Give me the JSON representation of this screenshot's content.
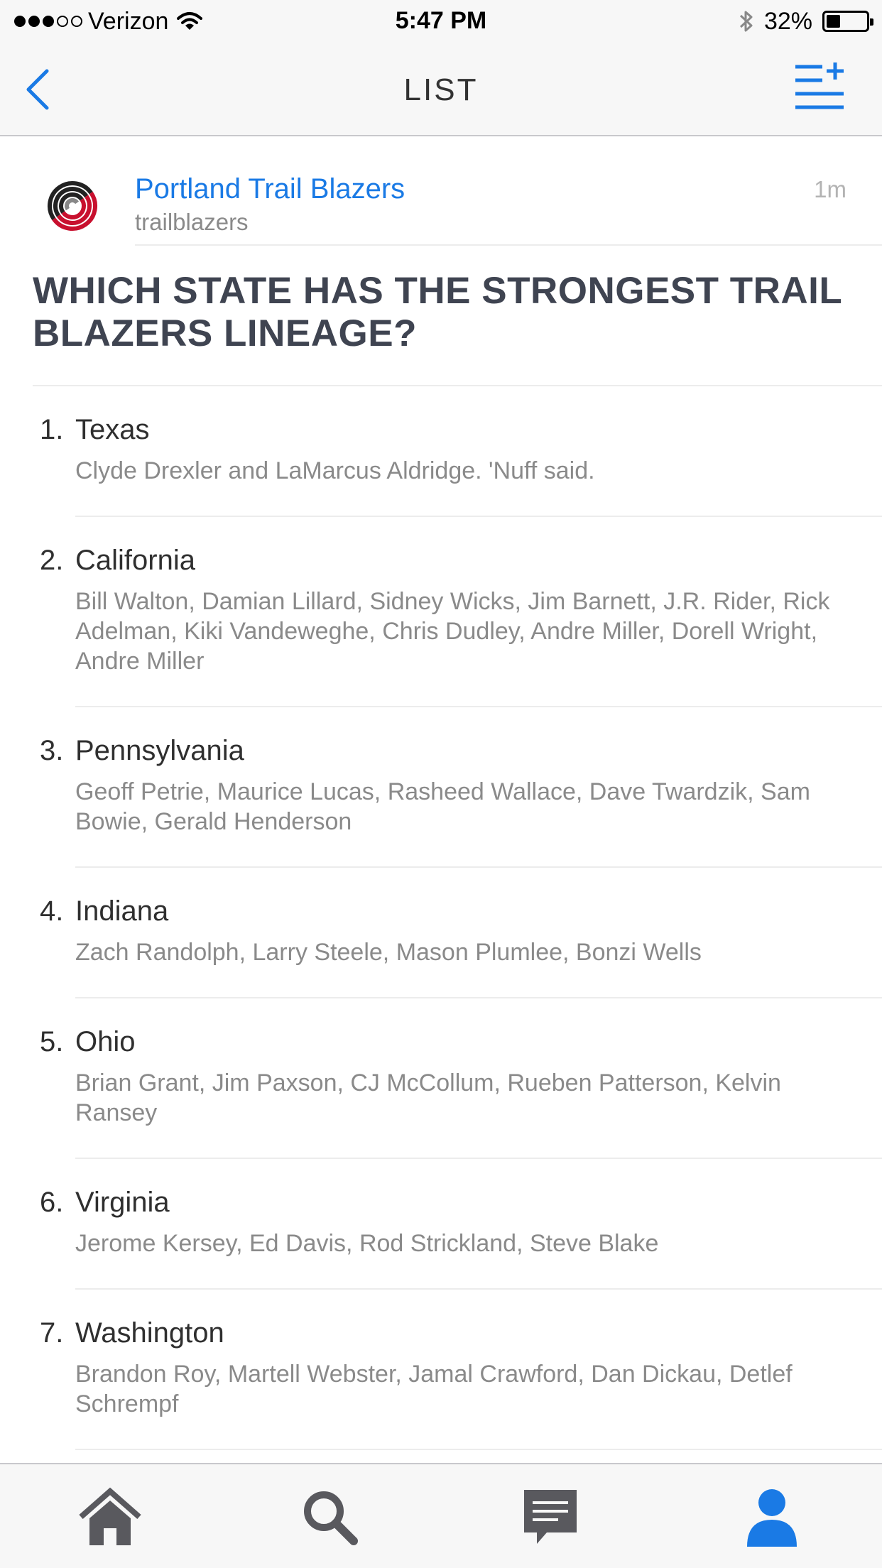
{
  "status_bar": {
    "carrier": "Verizon",
    "signal_dots": 5,
    "signal_filled": 3,
    "time": "5:47 PM",
    "battery_percent_text": "32%",
    "battery_level": 0.32
  },
  "nav": {
    "title": "LIST",
    "back_icon": "chevron-left-icon",
    "action_icon": "add-list-icon",
    "accent_color": "#1a7ae5"
  },
  "post": {
    "author_name": "Portland Trail Blazers",
    "author_handle": "trailblazers",
    "time_ago": "1m",
    "title": "WHICH STATE HAS THE STRONGEST TRAIL BLAZERS LINEAGE?"
  },
  "items": [
    {
      "number": "1.",
      "name": "Texas",
      "description": "Clyde Drexler and LaMarcus Aldridge. 'Nuff said."
    },
    {
      "number": "2.",
      "name": "California",
      "description": "Bill Walton, Damian Lillard, Sidney Wicks, Jim Barnett, J.R. Rider, Rick Adelman, Kiki Vandeweghe, Chris Dudley, Andre Miller, Dorell Wright, Andre Miller"
    },
    {
      "number": "3.",
      "name": "Pennsylvania",
      "description": "Geoff Petrie, Maurice Lucas, Rasheed Wallace, Dave Twardzik, Sam Bowie, Gerald Henderson"
    },
    {
      "number": "4.",
      "name": "Indiana",
      "description": "Zach Randolph, Larry Steele, Mason Plumlee, Bonzi Wells"
    },
    {
      "number": "5.",
      "name": "Ohio",
      "description": "Brian Grant, Jim Paxson, CJ McCollum, Rueben Patterson, Kelvin Ransey"
    },
    {
      "number": "6.",
      "name": "Virginia",
      "description": "Jerome Kersey, Ed Davis, Rod Strickland, Steve Blake"
    },
    {
      "number": "7.",
      "name": "Washington",
      "description": "Brandon Roy, Martell Webster, Jamal Crawford, Dan Dickau, Detlef Schrempf"
    }
  ],
  "tabbar": {
    "tabs": [
      "home-icon",
      "search-icon",
      "messages-icon",
      "profile-icon"
    ],
    "active_color": "#1a7ae5",
    "inactive_color": "#59595e"
  }
}
